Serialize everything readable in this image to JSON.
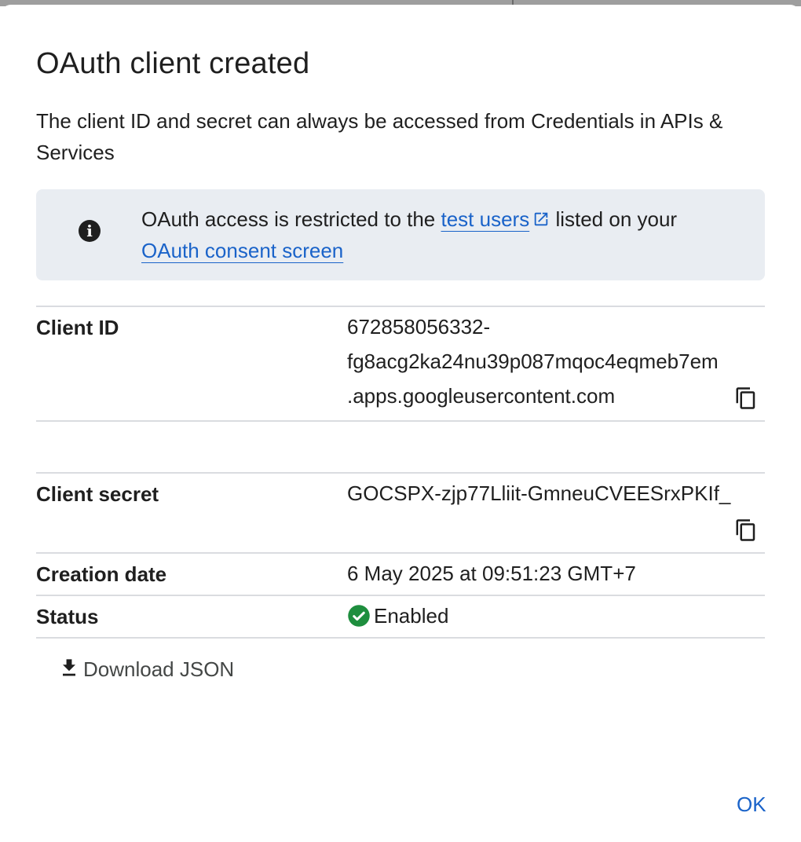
{
  "dialog": {
    "title": "OAuth client created",
    "subtitle": "The client ID and secret can always be accessed from Credentials in APIs & Services"
  },
  "notice": {
    "icon": "info-icon",
    "text_before": "OAuth access is restricted to the ",
    "link_test_users": "test users",
    "text_middle": " listed on your ",
    "link_consent": "OAuth consent screen"
  },
  "details": {
    "client_id_label": "Client ID",
    "client_id_line1": "672858056332-",
    "client_id_line2": "fg8acg2ka24nu39p087mqoc4eqmeb7em",
    "client_id_line3": ".apps.googleusercontent.com",
    "client_secret_label": "Client secret",
    "client_secret_value": "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",
    "creation_date_label": "Creation date",
    "creation_date_value": "6 May 2025 at 09:51:23 GMT+7",
    "status_label": "Status",
    "status_value": "Enabled"
  },
  "actions": {
    "download_label": "Download JSON",
    "ok_label": "OK"
  },
  "colors": {
    "link": "#1a63c9",
    "status_enabled": "#1e8e3e",
    "notice_bg": "#e9edf2"
  }
}
